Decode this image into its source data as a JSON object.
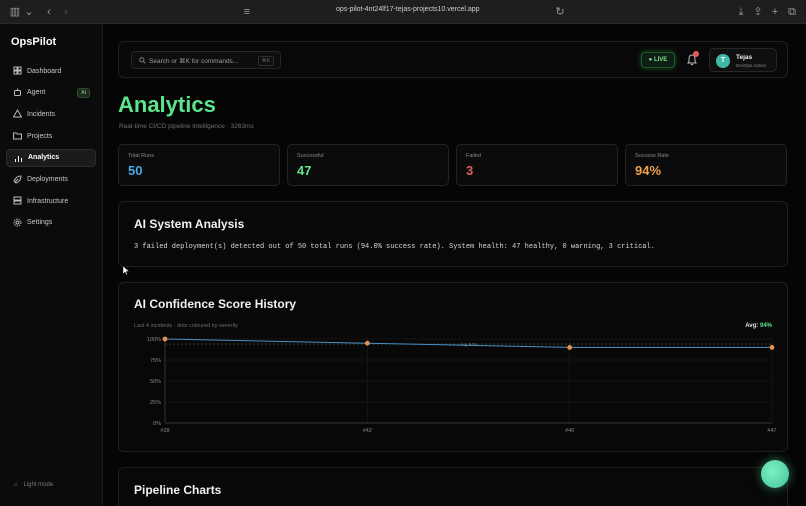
{
  "browser": {
    "url": "ops-pilot-4nt24lf17-tejas-projects10.vercel.app"
  },
  "sidebar": {
    "logo": "OpsPilot",
    "items": [
      {
        "label": "Dashboard",
        "icon": "dashboard-icon"
      },
      {
        "label": "Agent",
        "icon": "agent-icon",
        "badge": "AI"
      },
      {
        "label": "Incidents",
        "icon": "warning-icon"
      },
      {
        "label": "Projects",
        "icon": "folder-icon"
      },
      {
        "label": "Analytics",
        "icon": "analytics-icon",
        "active": true
      },
      {
        "label": "Deployments",
        "icon": "rocket-icon"
      },
      {
        "label": "Infrastructure",
        "icon": "server-icon"
      },
      {
        "label": "Settings",
        "icon": "gear-icon"
      }
    ],
    "light_mode": "Light mode"
  },
  "topbar": {
    "search_placeholder": "Search or ⌘K for commands...",
    "search_kbd": "⌘K",
    "live_label": "● LIVE",
    "user": {
      "initial": "T",
      "name": "Tejas",
      "role": "DevOps Admin"
    }
  },
  "page": {
    "title": "Analytics",
    "subtitle": "Real-time CI/CD pipeline intelligence · 3263ms"
  },
  "stats": [
    {
      "label": "Total Runs",
      "value": "50",
      "color": "#4aa8e8"
    },
    {
      "label": "Successful",
      "value": "47",
      "color": "#5de38a"
    },
    {
      "label": "Failed",
      "value": "3",
      "color": "#e25c5c"
    },
    {
      "label": "Success Rate",
      "value": "94%",
      "color": "#f0a050"
    }
  ],
  "analysis": {
    "title": "AI System Analysis",
    "text": "3 failed deployment(s) detected out of 50 total runs (94.0% success rate). System health: 47 healthy, 0 warning, 3 critical."
  },
  "confidence": {
    "title": "AI Confidence Score History",
    "subtitle": "Last 4 incidents · dots coloured by severity",
    "avg_label": "Avg:",
    "avg_value": "94%",
    "avg_line_label": "Avg 94%"
  },
  "pipeline": {
    "title": "Pipeline Charts"
  },
  "chart_data": {
    "type": "line",
    "x": [
      "#28",
      "#42",
      "#46",
      "#47"
    ],
    "values": [
      100,
      95,
      90,
      90
    ],
    "ylim": [
      0,
      100
    ],
    "yticks": [
      "0%",
      "25%",
      "50%",
      "75%",
      "100%"
    ],
    "avg": 94,
    "grid": true,
    "line_color": "#4a90c8",
    "dot_color": "#e8904a"
  }
}
